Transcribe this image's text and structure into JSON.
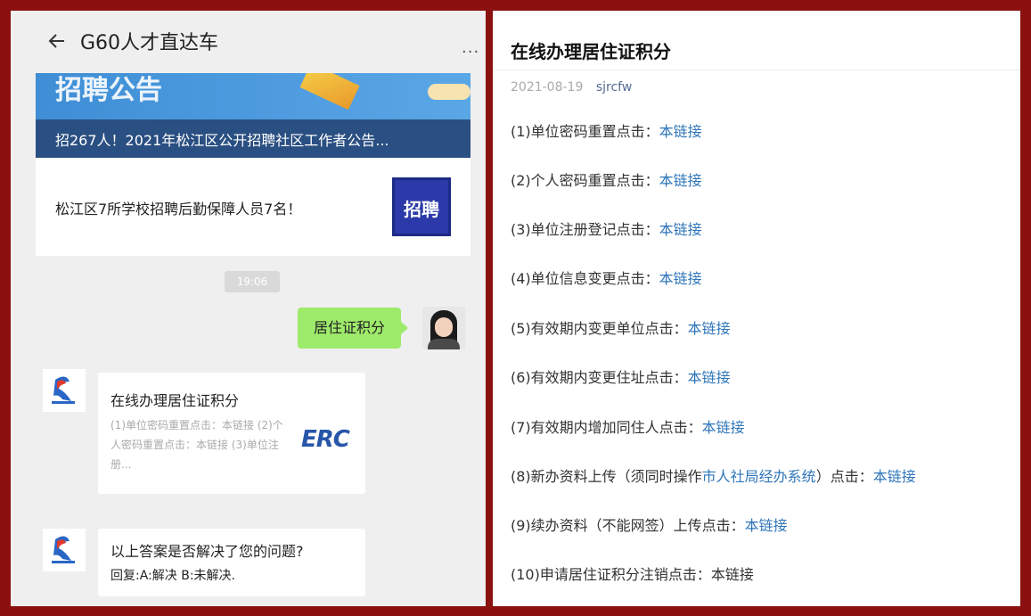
{
  "left": {
    "title": "G60人才直达车",
    "more": "···",
    "banner": {
      "hint": "招聘公告",
      "caption": "招267人！2021年松江区公开招聘社区工作者公告..."
    },
    "notice": {
      "text": "松江区7所学校招聘后勤保障人员7名！",
      "badge": "招聘"
    },
    "time": "19:06",
    "my_message": "居住证积分",
    "article": {
      "title": "在线办理居住证积分",
      "summary": "(1)单位密码重置点击：本链接 (2)个人密码重置点击：本链接 (3)单位注册...",
      "thumb_text": "ERC"
    },
    "reply": {
      "line1": "以上答案是否解决了您的问题?",
      "line2": "回复:A:解决    B:未解决."
    }
  },
  "right": {
    "title": "在线办理居住证积分",
    "date": "2021-08-19",
    "author": "sjrcfw",
    "items": [
      {
        "text": "(1)单位密码重置点击：",
        "link": "本链接"
      },
      {
        "text": "(2)个人密码重置点击：",
        "link": "本链接"
      },
      {
        "text": "(3)单位注册登记点击：",
        "link": "本链接"
      },
      {
        "text": "(4)单位信息变更点击：",
        "link": "本链接"
      },
      {
        "text": "(5)有效期内变更单位点击：",
        "link": "本链接"
      },
      {
        "text": "(6)有效期内变更住址点击：",
        "link": "本链接"
      },
      {
        "text": "(7)有效期内增加同住人点击：",
        "link": "本链接"
      },
      {
        "text": "(8)新办资料上传（须同时操作",
        "mid_link": "市人社局经办系统",
        "mid_text": "）点击：",
        "link": "本链接"
      },
      {
        "text": "(9)续办资料（不能网签）上传点击：",
        "link": "本链接"
      },
      {
        "text": "(10)申请居住证积分注销点击：",
        "plain": "本链接"
      }
    ]
  },
  "colors": {
    "frame": "#8b1010",
    "chat_bg": "#efefef",
    "my_bubble": "#9eea6a",
    "link": "#2f76b9"
  },
  "icons": [
    "back-arrow-icon",
    "more-icon",
    "bot-logo-icon",
    "user-avatar"
  ]
}
